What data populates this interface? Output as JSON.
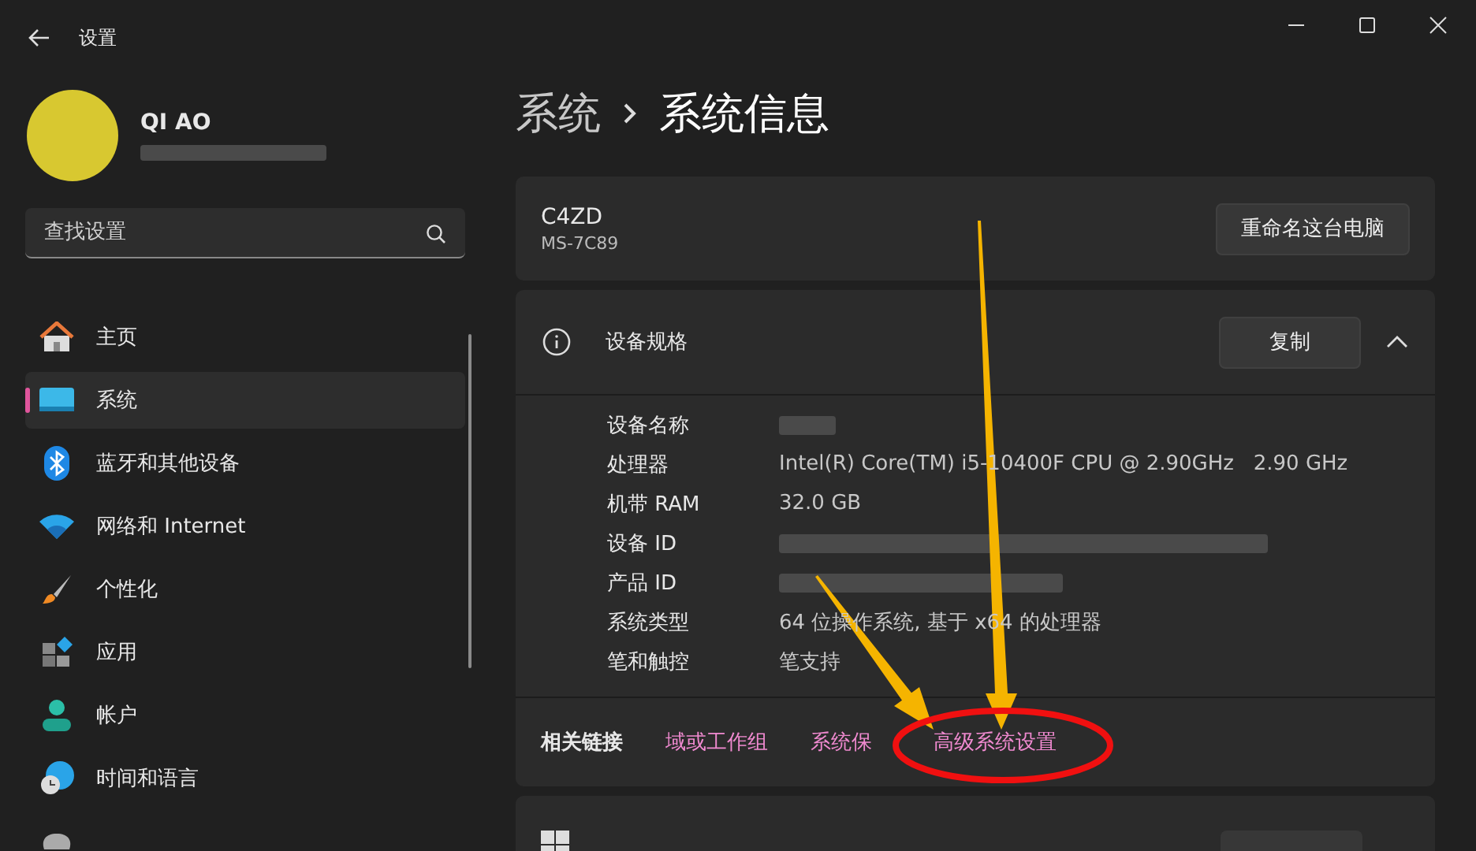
{
  "window": {
    "title": "设置"
  },
  "profile": {
    "name": "QI AO"
  },
  "search": {
    "placeholder": "查找设置"
  },
  "nav": [
    {
      "label": "主页",
      "selected": false
    },
    {
      "label": "系统",
      "selected": true
    },
    {
      "label": "蓝牙和其他设备",
      "selected": false
    },
    {
      "label": "网络和 Internet",
      "selected": false
    },
    {
      "label": "个性化",
      "selected": false
    },
    {
      "label": "应用",
      "selected": false
    },
    {
      "label": "帐户",
      "selected": false
    },
    {
      "label": "时间和语言",
      "selected": false
    },
    {
      "selected": false
    }
  ],
  "breadcrumb": [
    "系统",
    "系统信息"
  ],
  "device": {
    "name": "C4ZD",
    "model": "MS-7C89",
    "button": "重命名这台电脑"
  },
  "specs": {
    "title": "设备规格",
    "button": "复制",
    "expanded": true,
    "rows": [
      {
        "label": "设备名称",
        "kind": "redacted"
      },
      {
        "label": "处理器",
        "kind": "text",
        "value": "Intel(R) Core(TM) i5-10400F CPU @ 2.90GHz   2.90 GHz"
      },
      {
        "label": "机带 RAM",
        "kind": "text",
        "value": "32.0 GB"
      },
      {
        "label": "设备 ID",
        "kind": "redacted"
      },
      {
        "label": "产品 ID",
        "kind": "redacted"
      },
      {
        "label": "系统类型",
        "kind": "text",
        "value": "64 位操作系统, 基于 x64 的处理器"
      },
      {
        "label": "笔和触控",
        "kind": "text",
        "value": "笔支持"
      }
    ]
  },
  "related": {
    "label": "相关链接",
    "links": [
      "域或工作组",
      "系统保",
      "高级系统设置"
    ]
  }
}
